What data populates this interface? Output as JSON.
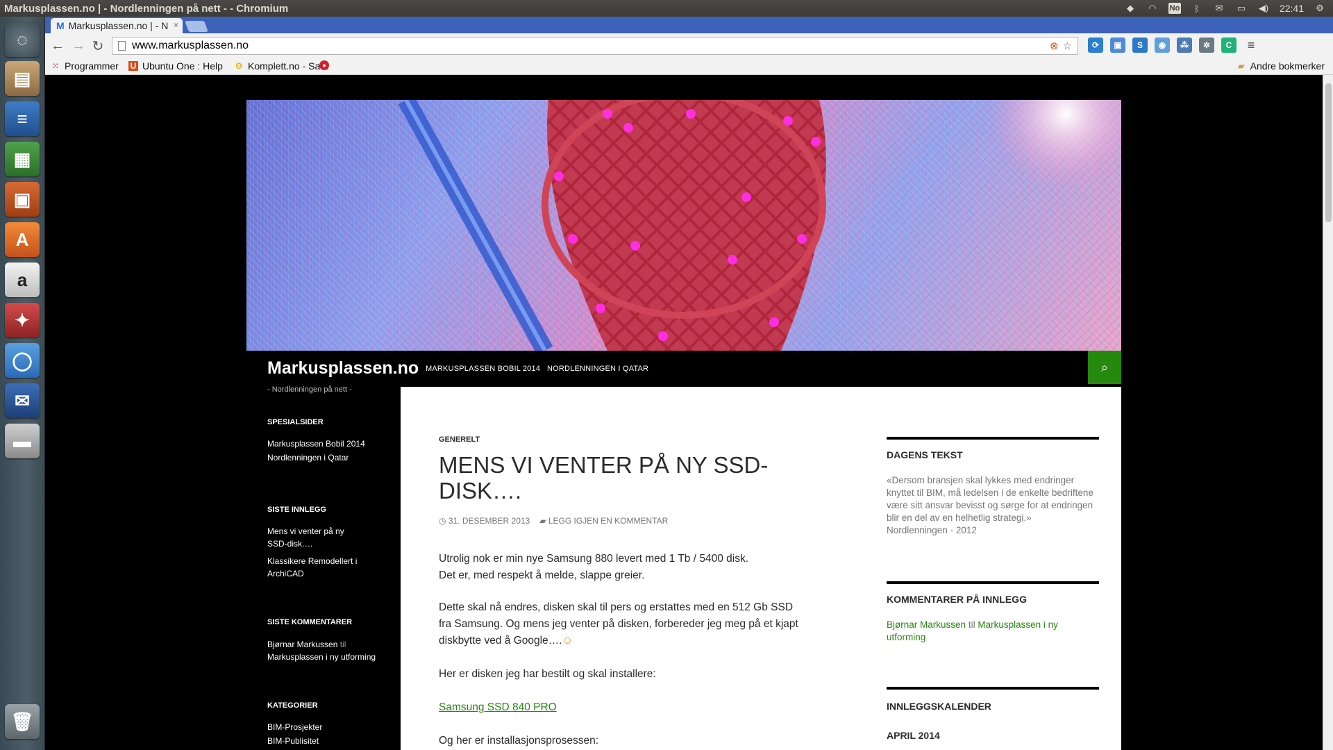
{
  "window": {
    "title": "Markusplassen.no | - Nordlenningen på nett - - Chromium"
  },
  "panel": {
    "keyboard_layout": "No",
    "clock": "22:41"
  },
  "tab": {
    "favicon": "M",
    "title": "Markusplassen.no | - N",
    "close": "×"
  },
  "omnibox": {
    "url": "www.markusplassen.no"
  },
  "bookmarks": {
    "apps": "Programmer",
    "items": [
      "Ubuntu One : Help",
      "Komplett.no - Sam"
    ],
    "other": "Andre bokmerker"
  },
  "site": {
    "title": "Markusplassen.no",
    "tagline": "- Nordlenningen på nett -",
    "nav": [
      "MARKUSPLASSEN BOBIL 2014",
      "NORDLENNINGEN I QATAR"
    ]
  },
  "left_sidebar": {
    "special": {
      "title": "SPESIALSIDER",
      "items": [
        "Markusplassen Bobil 2014",
        "Nordlenningen i Qatar"
      ]
    },
    "recent_posts": {
      "title": "SISTE INNLEGG",
      "items": [
        "Mens vi venter på ny SSD-disk….",
        "Klassikere Remodellert i ArchiCAD"
      ]
    },
    "recent_comments": {
      "title": "SISTE KOMMENTARER",
      "author": "Bjørnar Markussen",
      "connector": "til",
      "post": "Markusplassen i ny utforming"
    },
    "categories": {
      "title": "KATEGORIER",
      "items": [
        "BIM-Prosjekter",
        "BIM-Publisitet"
      ]
    }
  },
  "post": {
    "category": "GENERELT",
    "title": "MENS VI VENTER PÅ NY SSD-DISK….",
    "date": "31. DESEMBER 2013",
    "comment_link": "LEGG IGJEN EN KOMMENTAR",
    "p1_line1": "Utrolig nok er min nye Samsung 880 levert med 1 Tb / 5400 disk.",
    "p1_line2": "Det er, med respekt å melde, slappe greier.",
    "p2": "Dette skal nå endres, disken skal til pers og erstattes med en 512 Gb SSD fra Samsung. Og mens jeg venter på disken, forbereder jeg meg på et kjapt diskbytte ved å Google….",
    "p3": "Her er disken jeg har bestilt og skal installere:",
    "link": "Samsung SSD 840 PRO",
    "p4": "Og her er installasjonsprosessen:"
  },
  "right_sidebar": {
    "daily": {
      "title": "DAGENS TEKST",
      "quote": "«Dersom bransjen skal lykkes med endringer knyttet til BIM, må ledelsen i de enkelte bedriftene være sitt ansvar bevisst og sørge for at endringen blir en del av en helhetlig strategi.»",
      "source": "Nordlenningen - 2012"
    },
    "comments": {
      "title": "KOMMENTARER PÅ INNLEGG",
      "author": "Bjørnar Markussen",
      "connector": "til",
      "post": "Markusplassen i ny utforming"
    },
    "calendar": {
      "title": "INNLEGGSKALENDER",
      "month": "APRIL 2014"
    }
  },
  "colors": {
    "accent": "#24890d",
    "chrome_tab": "#3d62b9"
  }
}
